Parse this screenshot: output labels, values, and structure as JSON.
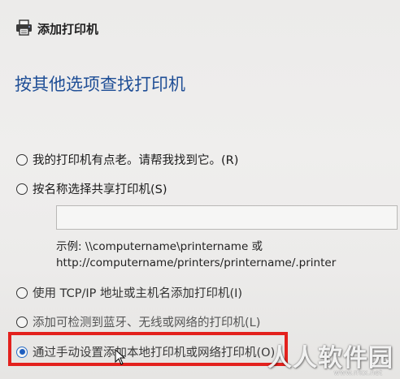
{
  "window": {
    "title": "添加打印机",
    "icon": "printer-icon"
  },
  "heading": "按其他选项查找打印机",
  "options": [
    {
      "label": "我的打印机有点老。请帮我找到它。(R)",
      "checked": false
    },
    {
      "label": "按名称选择共享打印机(S)",
      "checked": false
    },
    {
      "label": "使用 TCP/IP 地址或主机名添加打印机(I)",
      "checked": false
    },
    {
      "label": "添加可检测到蓝牙、无线或网络的打印机(L)",
      "checked": false
    },
    {
      "label": "通过手动设置添加本地打印机或网络打印机(O)",
      "checked": true
    }
  ],
  "share_input": {
    "value": ""
  },
  "example": {
    "line1": "示例: \\\\computername\\printername 或",
    "line2": "http://computername/printers/printername/.printer"
  },
  "watermark": {
    "text": "人人软件园",
    "url": "www.rrkx.net"
  },
  "colors": {
    "heading": "#1f4e96",
    "highlight": "#e3211d",
    "radio_checked": "#1f5fbf"
  }
}
